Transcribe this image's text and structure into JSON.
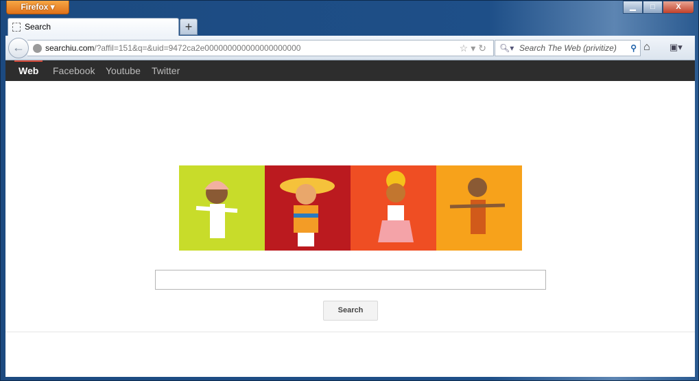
{
  "browser": {
    "menu_label": "Firefox ▾",
    "tab_title": "Search",
    "new_tab": "+",
    "url_host": "searchiu.com",
    "url_rest": "/?affil=151&q=&uid=9472ca2e000000000000000000000",
    "search_placeholder": "Search The Web (privitize)",
    "window_controls": {
      "minimize": "▁",
      "maximize": "□",
      "close": "X"
    }
  },
  "nav": {
    "items": [
      "Web",
      "Facebook",
      "Youtube",
      "Twitter"
    ],
    "active": "Web"
  },
  "page": {
    "search_value": "",
    "search_button": "Search",
    "banner_colors": [
      "#c8dc2a",
      "#bb1a1f",
      "#ef4e23",
      "#f7a21b"
    ]
  }
}
